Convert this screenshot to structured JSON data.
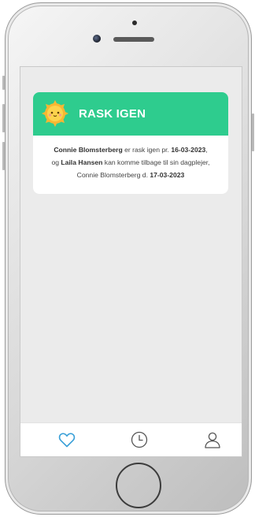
{
  "status_card": {
    "title": "RASK IGEN",
    "line1": {
      "name": "Connie Blomsterberg",
      "text": " er rask igen pr. ",
      "date": "16-03-2023",
      "end": ","
    },
    "line2": {
      "prefix": "og ",
      "name": "Laila Hansen",
      "text": " kan komme tilbage til sin dagplejer,"
    },
    "line3": {
      "text": "Connie Blomsterberg d. ",
      "date": "17-03-2023"
    }
  },
  "tabbar": {
    "items": [
      {
        "icon": "heart-icon",
        "active": true
      },
      {
        "icon": "clock-icon",
        "active": false
      },
      {
        "icon": "user-icon",
        "active": false
      }
    ]
  },
  "colors": {
    "header_green": "#2ecc8e",
    "active_tab": "#3aa0d8",
    "inactive_tab": "#555555"
  }
}
